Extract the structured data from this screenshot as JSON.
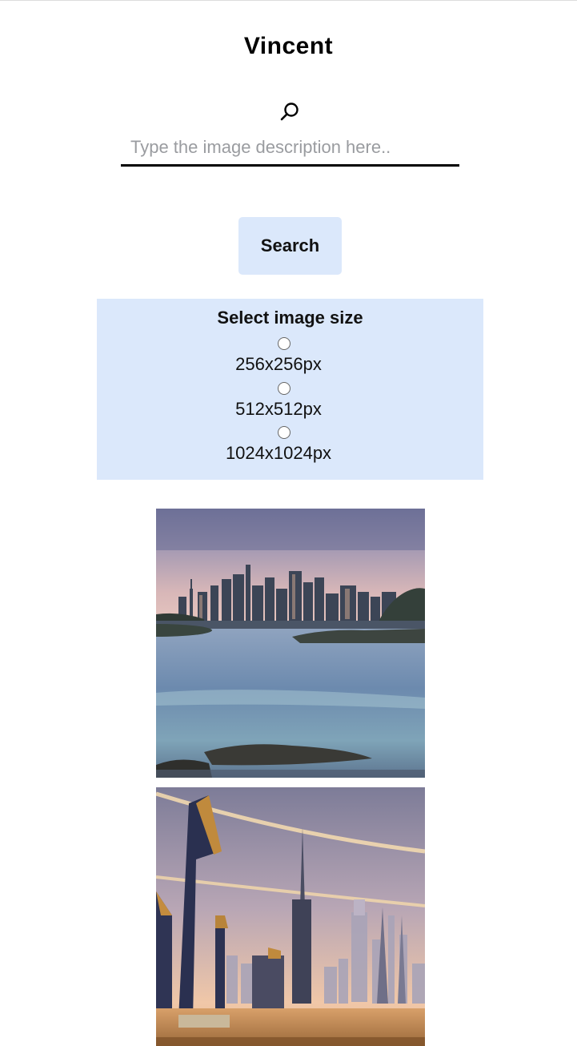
{
  "app": {
    "title": "Vincent"
  },
  "search": {
    "icon": "search-icon",
    "placeholder": "Type the image description here..",
    "value": "",
    "button_label": "Search"
  },
  "size_selector": {
    "heading": "Select image size",
    "options": [
      {
        "label": "256x256px",
        "selected": false
      },
      {
        "label": "512x512px",
        "selected": false
      },
      {
        "label": "1024x1024px",
        "selected": false
      }
    ]
  },
  "colors": {
    "accent": "#dbe8fb",
    "placeholder_text": "#9a9ca0"
  },
  "results": [
    {
      "subject": "harbour city skyline at dusk with calm water and rocks"
    },
    {
      "subject": "futuristic city skyline with towers and glowing rings at sunset"
    }
  ]
}
